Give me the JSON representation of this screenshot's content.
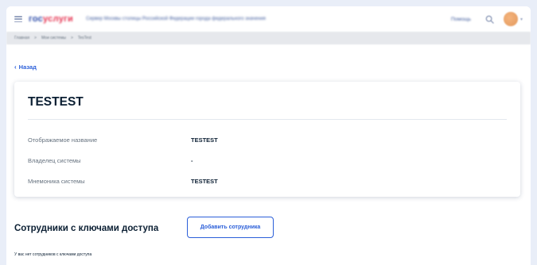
{
  "header": {
    "logo_part1": "гос",
    "logo_part2": "услуги",
    "title": "Сервер Москвы столицы Российской Федерации города федерального значения",
    "help_label": "Помощь"
  },
  "breadcrumbs": [
    "Главная",
    "Мои системы",
    "TesTest"
  ],
  "back_link": {
    "label": "Назад"
  },
  "system_card": {
    "title": "TESTEST",
    "rows": [
      {
        "label": "Отображаемое название",
        "value": "TESTEST"
      },
      {
        "label": "Владелец системы",
        "value": "-"
      },
      {
        "label": "Мнемоника системы",
        "value": "TESTEST"
      }
    ]
  },
  "employees": {
    "title": "Сотрудники с ключами доступа",
    "add_button_label": "Добавить сотрудника",
    "empty_note": "У вас нет сотрудников с ключами доступа"
  },
  "colors": {
    "accent": "#2b5fd9",
    "text": "#0b1f33",
    "muted": "#66727f",
    "background": "#e9eef8"
  },
  "icons": [
    "menu-icon",
    "search-icon",
    "avatar",
    "chevron-down-icon",
    "chevron-left-icon"
  ]
}
